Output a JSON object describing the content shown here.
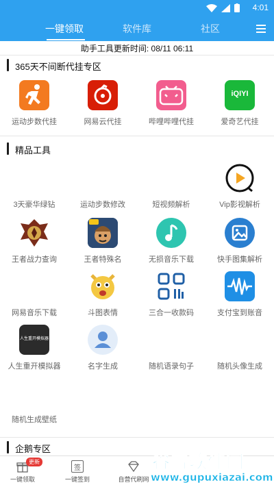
{
  "status_bar": {
    "time": "4:01"
  },
  "tabs": [
    {
      "label": "一键领取",
      "active": true
    },
    {
      "label": "软件库",
      "active": false
    },
    {
      "label": "社区",
      "active": false
    }
  ],
  "update_line": "助手工具更新时间: 08/11 06:11",
  "section1": {
    "title": "365天不间断代挂专区",
    "items": [
      {
        "label": "运动步数代挂",
        "icon": "running-icon"
      },
      {
        "label": "网易云代挂",
        "icon": "netease-music-icon"
      },
      {
        "label": "哔哩哔哩代挂",
        "icon": "bilibili-icon"
      },
      {
        "label": "爱奇艺代挂",
        "icon": "iqiyi-icon",
        "icon_text": "iQIYI"
      }
    ]
  },
  "section2": {
    "title": "精品工具",
    "items": [
      {
        "label": "3天豪华绿钻",
        "icon": "none"
      },
      {
        "label": "运动步数修改",
        "icon": "none"
      },
      {
        "label": "短视频解析",
        "icon": "none"
      },
      {
        "label": "Vip影视解析",
        "icon": "play-icon"
      },
      {
        "label": "王者战力查询",
        "icon": "hero-emblem-icon"
      },
      {
        "label": "王者特殊名",
        "icon": "game-character-icon"
      },
      {
        "label": "无损音乐下载",
        "icon": "music-note-icon"
      },
      {
        "label": "快手图集解析",
        "icon": "image-gallery-icon"
      },
      {
        "label": "网易音乐下载",
        "icon": "none"
      },
      {
        "label": "斗图表情",
        "icon": "cat-emoji-icon"
      },
      {
        "label": "三合一收款码",
        "icon": "qr-code-icon"
      },
      {
        "label": "支付宝到账音",
        "icon": "audio-wave-icon"
      },
      {
        "label": "人生重开模拟器",
        "icon": "life-restart-icon",
        "icon_text": "人生重开模拟器"
      },
      {
        "label": "名字生成",
        "icon": "user-avatar-icon"
      },
      {
        "label": "随机语录句子",
        "icon": "none"
      },
      {
        "label": "随机头像生成",
        "icon": "none"
      },
      {
        "label": "随机生成壁纸",
        "icon": "none"
      }
    ]
  },
  "section3": {
    "title": "企鹅专区"
  },
  "bottom_nav": [
    {
      "label": "一键领取",
      "icon": "gift-icon",
      "badge": "更新"
    },
    {
      "label": "一键签到",
      "icon": "sign-in-icon",
      "icon_text": "签"
    },
    {
      "label": "自营代刷网",
      "icon": "diamond-icon"
    }
  ],
  "watermark": {
    "title": "谷普软件园",
    "url": "www.gupuxiazai.com"
  },
  "colors": {
    "accent": "#2fa1ef",
    "watermark": "#19b3e6"
  }
}
